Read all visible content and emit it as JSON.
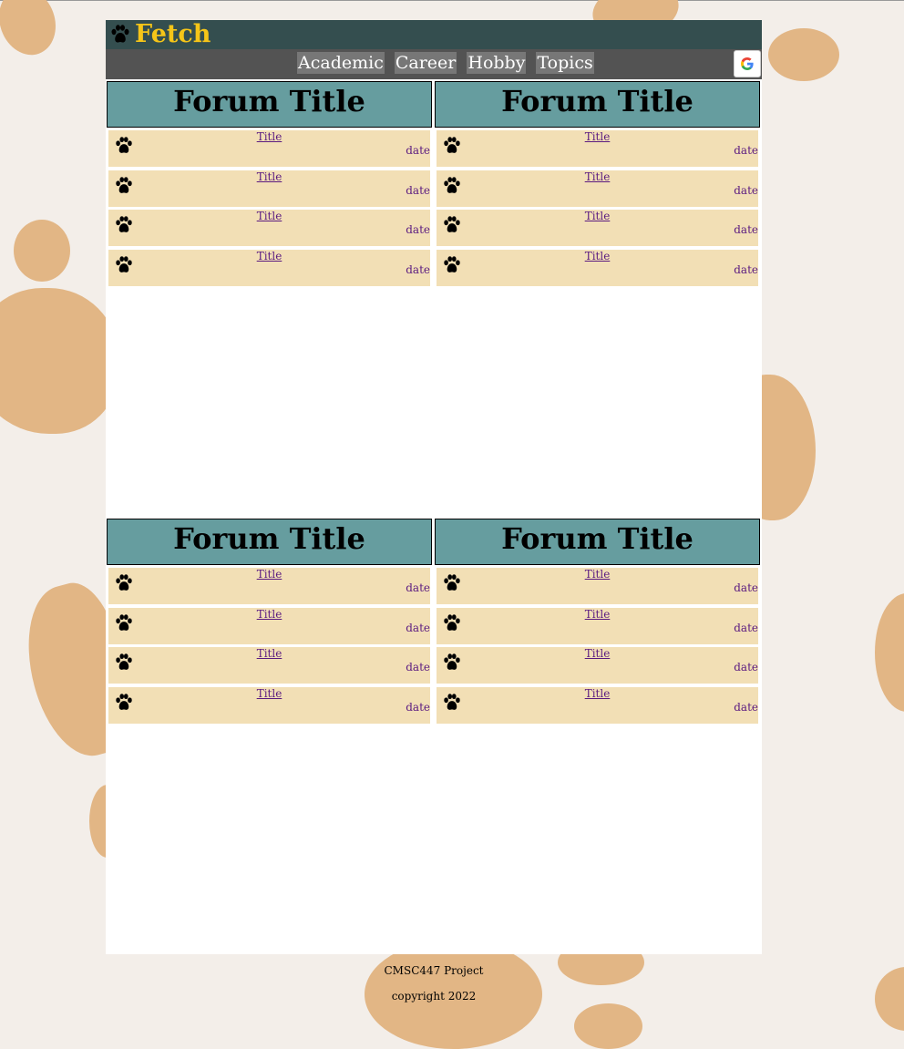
{
  "header": {
    "brand": "Fetch",
    "logo_icon": "paw-icon",
    "brand_color": "#f5c518"
  },
  "nav": {
    "links": [
      "Academic",
      "Career",
      "Hobby",
      "Topics"
    ],
    "google_icon": "google-icon"
  },
  "forums": [
    {
      "title": "Forum Title",
      "rows": [
        {
          "title": "Title",
          "date": "date"
        },
        {
          "title": "Title",
          "date": "date"
        },
        {
          "title": "Title",
          "date": "date"
        },
        {
          "title": "Title",
          "date": "date"
        }
      ]
    },
    {
      "title": "Forum Title",
      "rows": [
        {
          "title": "Title",
          "date": "date"
        },
        {
          "title": "Title",
          "date": "date"
        },
        {
          "title": "Title",
          "date": "date"
        },
        {
          "title": "Title",
          "date": "date"
        }
      ]
    },
    {
      "title": "Forum Title",
      "rows": [
        {
          "title": "Title",
          "date": "date"
        },
        {
          "title": "Title",
          "date": "date"
        },
        {
          "title": "Title",
          "date": "date"
        },
        {
          "title": "Title",
          "date": "date"
        }
      ]
    },
    {
      "title": "Forum Title",
      "rows": [
        {
          "title": "Title",
          "date": "date"
        },
        {
          "title": "Title",
          "date": "date"
        },
        {
          "title": "Title",
          "date": "date"
        },
        {
          "title": "Title",
          "date": "date"
        }
      ]
    }
  ],
  "footer": {
    "project": "CMSC447 Project",
    "copyright": "copyright 2022"
  },
  "colors": {
    "header_bg": "#344e4f",
    "nav_bg": "#535353",
    "forum_header_bg": "#669d9f",
    "row_bg": "#f2dfb5",
    "link_color": "#5a1a80",
    "paw_print_bg": "#e2b685"
  }
}
